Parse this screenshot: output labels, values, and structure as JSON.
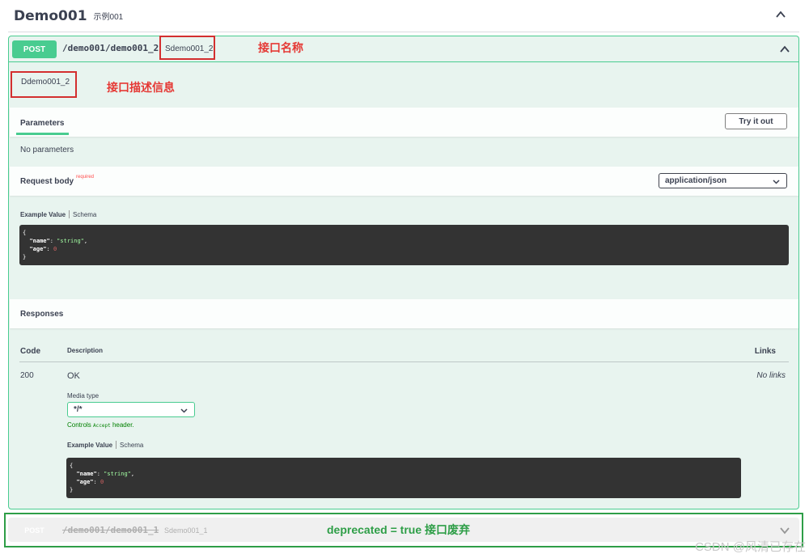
{
  "tag": {
    "title": "Demo001",
    "description": "示例001"
  },
  "operation": {
    "method": "POST",
    "path": "/demo001/demo001_2",
    "summary": "Sdemo001_2",
    "description": "Ddemo001_2",
    "parameters_tab": "Parameters",
    "try_it_out": "Try it out",
    "no_parameters": "No parameters",
    "request_body": {
      "title": "Request body",
      "required": "required",
      "content_type": "application/json",
      "example_tab": "Example Value",
      "schema_tab": "Schema"
    },
    "example_json": {
      "name_key": "\"name\"",
      "name_value": "\"string\"",
      "age_key": "\"age\"",
      "age_value": "0"
    },
    "responses": {
      "title": "Responses",
      "headers": {
        "code": "Code",
        "description": "Description",
        "links": "Links"
      },
      "rows": [
        {
          "code": "200",
          "description": "OK",
          "links": "No links",
          "media_type_label": "Media type",
          "media_type": "*/*",
          "controls_prefix": "Controls",
          "controls_code": "Accept",
          "controls_suffix": "header.",
          "example_tab": "Example Value",
          "schema_tab": "Schema"
        }
      ]
    }
  },
  "deprecated_operation": {
    "method": "POST",
    "path": "/demo001/demo001_1",
    "summary": "Sdemo001_1"
  },
  "annotations": {
    "name_label": "接口名称",
    "desc_label": "接口描述信息",
    "deprecated_label": "deprecated = true  接口废弃"
  },
  "watermark": "CSDN @风清已存在",
  "colors": {
    "post_green": "#49cc90",
    "annotation_red": "#e53935",
    "annotation_green": "#2e9e47",
    "code_bg": "#333333"
  }
}
